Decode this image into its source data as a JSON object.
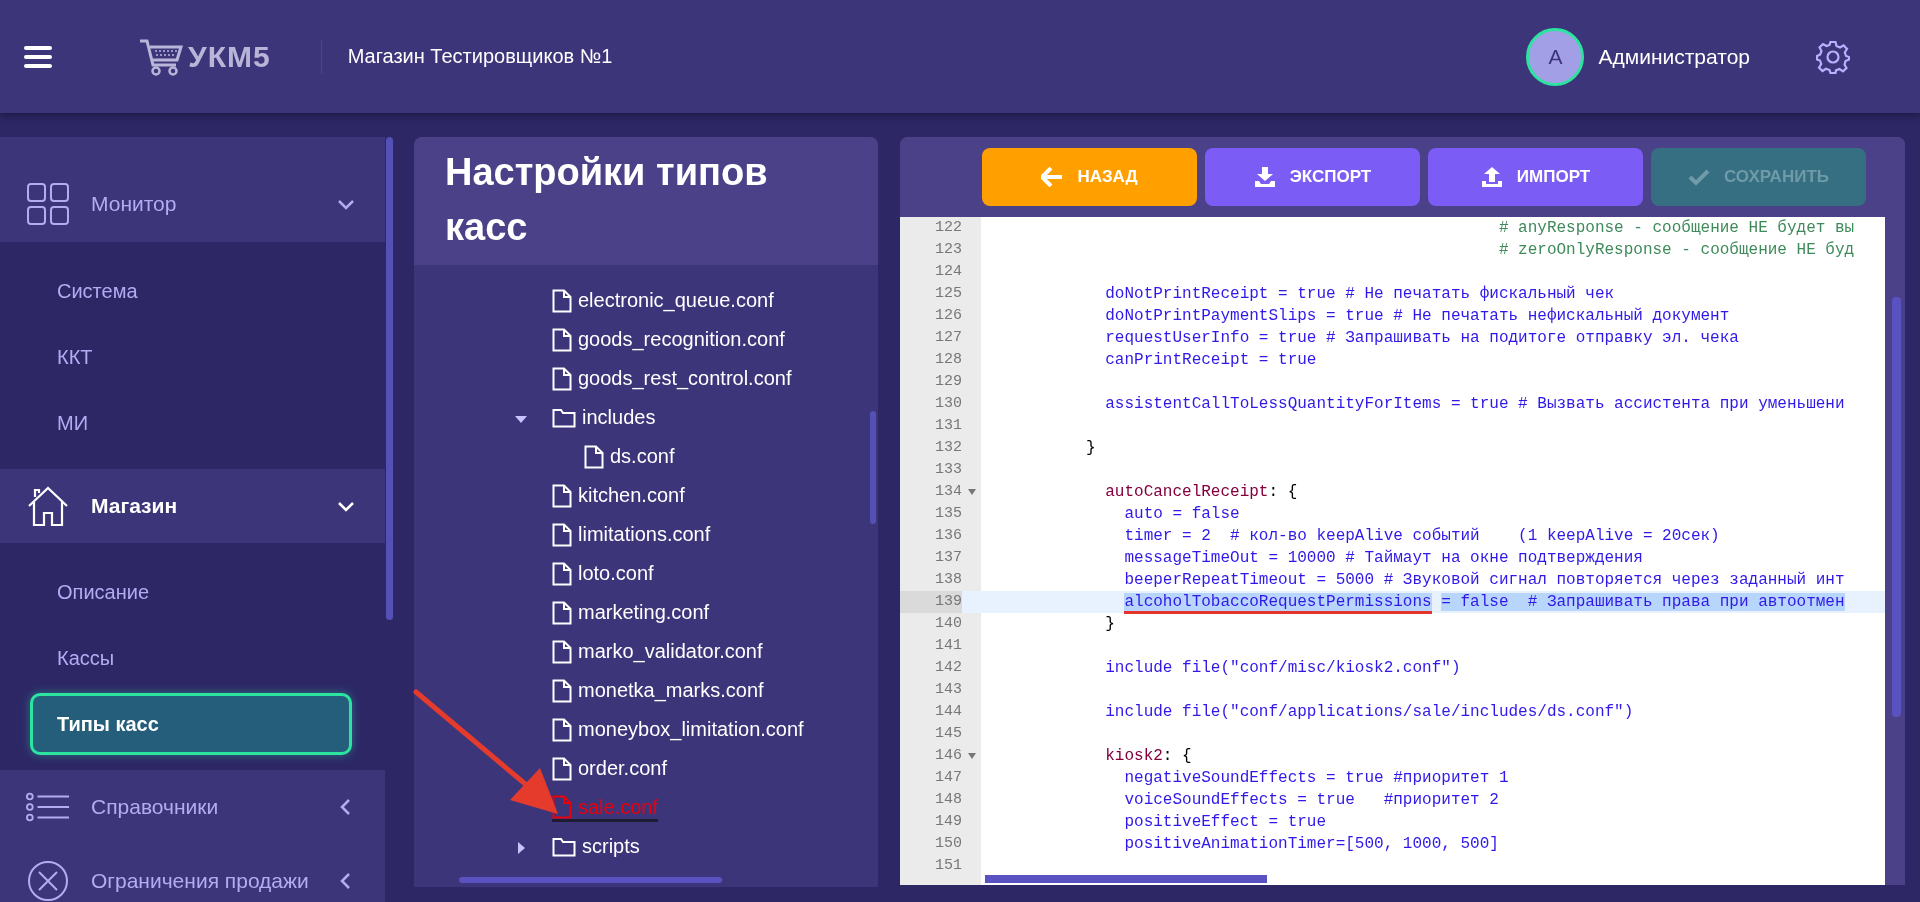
{
  "header": {
    "logo": "УКМ5",
    "store": "Магазин Тестировщиков №1",
    "user": {
      "initial": "А",
      "name": "Администратор"
    }
  },
  "sidebar": {
    "items": [
      {
        "label": "Монитор",
        "expanded": true,
        "active": false,
        "children": [
          {
            "label": "Система",
            "selected": false
          },
          {
            "label": "ККТ",
            "selected": false
          },
          {
            "label": "МИ",
            "selected": false
          }
        ]
      },
      {
        "label": "Магазин",
        "expanded": true,
        "active": true,
        "children": [
          {
            "label": "Описание",
            "selected": false
          },
          {
            "label": "Кассы",
            "selected": false
          },
          {
            "label": "Типы касс",
            "selected": true
          }
        ]
      },
      {
        "label": "Справочники",
        "expanded": false,
        "active": false
      },
      {
        "label": "Ограничения продажи",
        "expanded": false,
        "active": false
      }
    ]
  },
  "tree_panel": {
    "title": "Настройки типов касс",
    "nodes": [
      {
        "label": "electronic_queue.conf",
        "kind": "file",
        "selected": false
      },
      {
        "label": "goods_recognition.conf",
        "kind": "file",
        "selected": false
      },
      {
        "label": "goods_rest_control.conf",
        "kind": "file",
        "selected": false
      },
      {
        "label": "includes",
        "kind": "folder",
        "expanded": true,
        "selected": false,
        "children": [
          {
            "label": "ds.conf",
            "kind": "file",
            "selected": false
          }
        ]
      },
      {
        "label": "kitchen.conf",
        "kind": "file",
        "selected": false
      },
      {
        "label": "limitations.conf",
        "kind": "file",
        "selected": false
      },
      {
        "label": "loto.conf",
        "kind": "file",
        "selected": false
      },
      {
        "label": "marketing.conf",
        "kind": "file",
        "selected": false
      },
      {
        "label": "marko_validator.conf",
        "kind": "file",
        "selected": false
      },
      {
        "label": "monetka_marks.conf",
        "kind": "file",
        "selected": false
      },
      {
        "label": "moneybox_limitation.conf",
        "kind": "file",
        "selected": false
      },
      {
        "label": "order.conf",
        "kind": "file",
        "selected": false
      },
      {
        "label": "sale.conf",
        "kind": "file",
        "selected": true
      },
      {
        "label": "scripts",
        "kind": "folder",
        "expanded": false,
        "selected": false
      }
    ]
  },
  "toolbar": {
    "buttons": [
      {
        "label": "НАЗАД",
        "kind": "back",
        "disabled": false
      },
      {
        "label": "ЭКСПОРТ",
        "kind": "export",
        "disabled": false
      },
      {
        "label": "ИМПОРТ",
        "kind": "import",
        "disabled": false
      },
      {
        "label": "СОХРАНИТЬ",
        "kind": "save",
        "disabled": true
      }
    ]
  },
  "editor": {
    "lines": [
      {
        "number": "122",
        "fold": false,
        "selected": false,
        "segments": [
          {
            "kind": "comment",
            "text": "                                                     # anyResponse - сообщение НЕ будет вы"
          }
        ]
      },
      {
        "number": "123",
        "fold": false,
        "selected": false,
        "segments": [
          {
            "kind": "comment",
            "text": "                                                     # zeroOnlyResponse - сообщение НЕ буд"
          }
        ]
      },
      {
        "number": "124",
        "fold": false,
        "selected": false
      },
      {
        "number": "125",
        "fold": false,
        "selected": false,
        "segments": [
          {
            "kind": "key",
            "text": "            doNotPrintReceipt = true # Не печатать фискальный чек"
          }
        ]
      },
      {
        "number": "126",
        "fold": false,
        "selected": false,
        "segments": [
          {
            "kind": "key",
            "text": "            doNotPrintPaymentSlips = true # Не печатать нефискальный документ"
          }
        ]
      },
      {
        "number": "127",
        "fold": false,
        "selected": false,
        "segments": [
          {
            "kind": "key",
            "text": "            requestUserInfo = true # Запрашивать на подитоге отправку эл. чека"
          }
        ]
      },
      {
        "number": "128",
        "fold": false,
        "selected": false,
        "segments": [
          {
            "kind": "key",
            "text": "            canPrintReceipt = true"
          }
        ]
      },
      {
        "number": "129",
        "fold": false,
        "selected": false
      },
      {
        "number": "130",
        "fold": false,
        "selected": false,
        "segments": [
          {
            "kind": "key",
            "text": "            assistentCallToLessQuantityForItems = true # Вызвать ассистента при уменьшени"
          }
        ]
      },
      {
        "number": "131",
        "fold": false,
        "selected": false
      },
      {
        "number": "132",
        "fold": false,
        "selected": false,
        "segments": [
          {
            "kind": "punct",
            "text": "          }"
          }
        ]
      },
      {
        "number": "133",
        "fold": false,
        "selected": false
      },
      {
        "number": "134",
        "fold": true,
        "selected": false,
        "segments": [
          {
            "kind": "section",
            "text": "            autoCancelReceipt"
          },
          {
            "kind": "punct",
            "text": ": {"
          }
        ]
      },
      {
        "number": "135",
        "fold": false,
        "selected": false,
        "segments": [
          {
            "kind": "key",
            "text": "              auto = false"
          }
        ]
      },
      {
        "number": "136",
        "fold": false,
        "selected": false,
        "segments": [
          {
            "kind": "key",
            "text": "              timer = 2  # кол-во keepAlive событий    (1 keepAlive = 20сек)"
          }
        ]
      },
      {
        "number": "137",
        "fold": false,
        "selected": false,
        "segments": [
          {
            "kind": "key",
            "text": "              messageTimeOut = 10000 # Таймаут на окне подтверждения"
          }
        ]
      },
      {
        "number": "138",
        "fold": false,
        "selected": false,
        "segments": [
          {
            "kind": "key",
            "text": "              beeperRepeatTimeout = 5000 # Звуковой сигнал повторяется через заданный инт"
          }
        ]
      },
      {
        "number": "139",
        "fold": false,
        "selected": true,
        "segments": [
          {
            "kind": "key",
            "text": "              alcoholTobaccoRequestPermissions",
            "annotated": true
          },
          {
            "kind": "key",
            "text": " = false  # Запрашивать права при автоотмен"
          }
        ]
      },
      {
        "number": "140",
        "fold": false,
        "selected": false,
        "segments": [
          {
            "kind": "punct",
            "text": "            }"
          }
        ]
      },
      {
        "number": "141",
        "fold": false,
        "selected": false
      },
      {
        "number": "142",
        "fold": false,
        "selected": false,
        "segments": [
          {
            "kind": "key",
            "text": "            include file(\"conf/misc/kiosk2.conf\")"
          }
        ]
      },
      {
        "number": "143",
        "fold": false,
        "selected": false
      },
      {
        "number": "144",
        "fold": false,
        "selected": false,
        "segments": [
          {
            "kind": "key",
            "text": "            include file(\"conf/applications/sale/includes/ds.conf\")"
          }
        ]
      },
      {
        "number": "145",
        "fold": false,
        "selected": false
      },
      {
        "number": "146",
        "fold": true,
        "selected": false,
        "segments": [
          {
            "kind": "section",
            "text": "            kiosk2"
          },
          {
            "kind": "punct",
            "text": ": {"
          }
        ]
      },
      {
        "number": "147",
        "fold": false,
        "selected": false,
        "segments": [
          {
            "kind": "key",
            "text": "              negativeSoundEffects = true #приоритет 1"
          }
        ]
      },
      {
        "number": "148",
        "fold": false,
        "selected": false,
        "segments": [
          {
            "kind": "key",
            "text": "              voiceSoundEffects = true   #приоритет 2"
          }
        ]
      },
      {
        "number": "149",
        "fold": false,
        "selected": false,
        "segments": [
          {
            "kind": "key",
            "text": "              positiveEffect = true"
          }
        ]
      },
      {
        "number": "150",
        "fold": false,
        "selected": false,
        "segments": [
          {
            "kind": "key",
            "text": "              positiveAnimationTimer=[500, 1000, 500]"
          }
        ]
      },
      {
        "number": "151",
        "fold": false,
        "selected": false
      }
    ]
  }
}
